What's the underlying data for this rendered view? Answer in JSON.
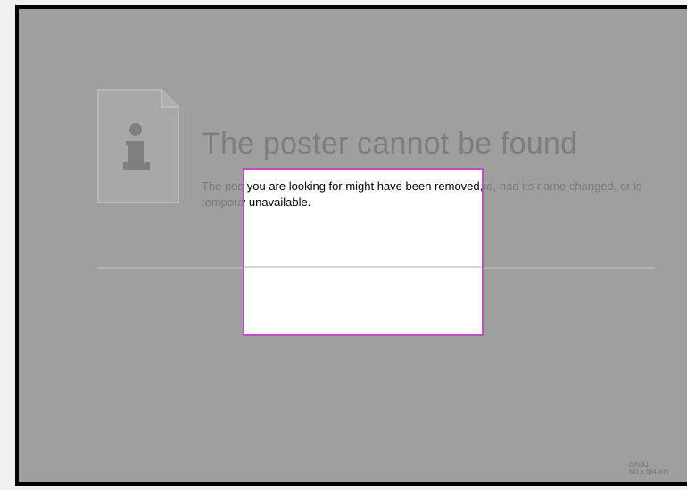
{
  "poster": {
    "title": "The poster cannot be found",
    "description": "The poster you are looking for might have been removed, had its name changed, or is temporarily unavailable.",
    "icon": "info-document-icon",
    "paper_size": "DIN A1",
    "paper_dimensions": "841 x 594 mm"
  },
  "colors": {
    "frame_background": "#9f9f9f",
    "title_text": "#7e7e7e",
    "highlight_border": "#c24ec6",
    "highlight_background": "#ffffff"
  }
}
